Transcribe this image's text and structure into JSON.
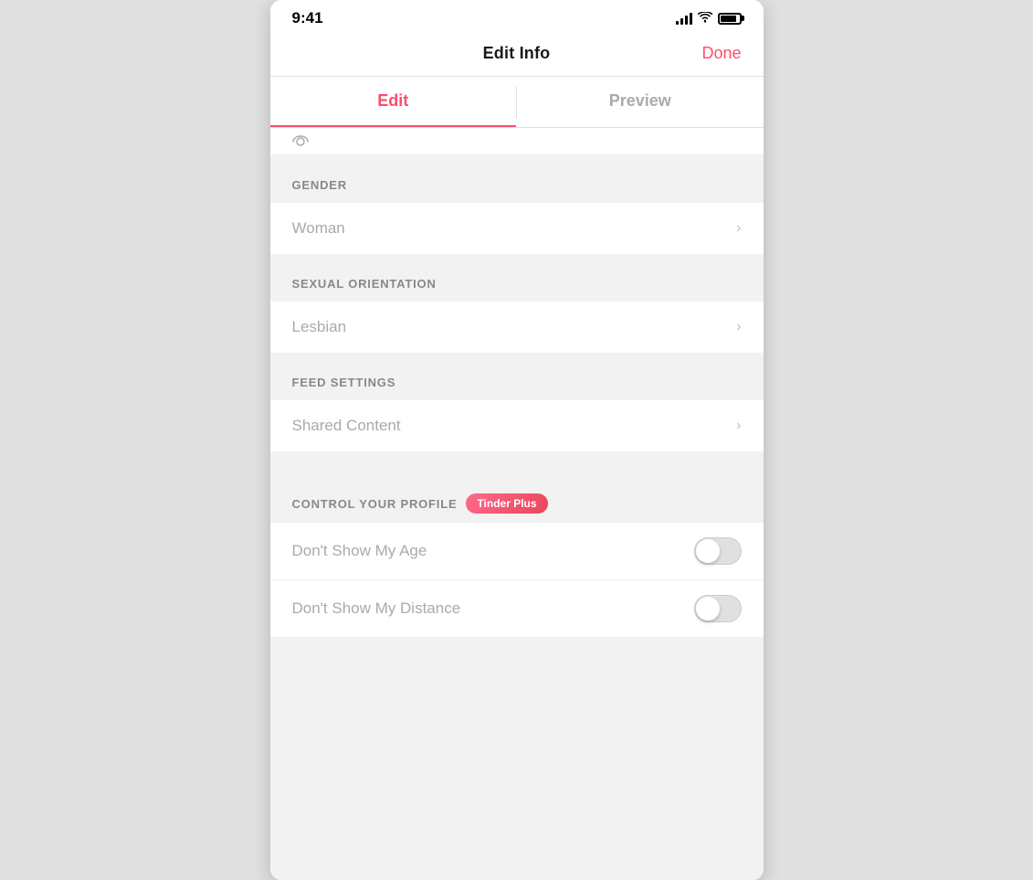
{
  "statusBar": {
    "time": "9:41",
    "icons": {
      "signal": "signal-icon",
      "wifi": "wifi-icon",
      "battery": "battery-icon"
    }
  },
  "navBar": {
    "title": "Edit Info",
    "doneLabel": "Done"
  },
  "tabs": [
    {
      "label": "Edit",
      "active": true
    },
    {
      "label": "Preview",
      "active": false
    }
  ],
  "sections": [
    {
      "id": "gender",
      "headerLabel": "GENDER",
      "items": [
        {
          "label": "Woman",
          "hasChevron": true
        }
      ]
    },
    {
      "id": "sexual-orientation",
      "headerLabel": "SEXUAL ORIENTATION",
      "items": [
        {
          "label": "Lesbian",
          "hasChevron": true
        }
      ]
    },
    {
      "id": "feed-settings",
      "headerLabel": "FEED SETTINGS",
      "items": [
        {
          "label": "Shared Content",
          "hasChevron": true
        }
      ]
    },
    {
      "id": "control-profile",
      "headerLabel": "CONTROL YOUR PROFILE",
      "badgeLabel": "Tinder Plus",
      "toggleItems": [
        {
          "label": "Don't Show My Age",
          "enabled": false
        },
        {
          "label": "Don't Show My Distance",
          "enabled": false
        }
      ]
    }
  ],
  "colors": {
    "accent": "#fc4d6b",
    "headerText": "#888888",
    "itemText": "#aaaaaa",
    "sectionBg": "#f2f2f2",
    "itemBg": "#ffffff",
    "toggleBg": "#e0e0e0",
    "badgeBg": "#e8455a"
  }
}
